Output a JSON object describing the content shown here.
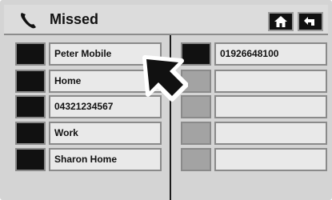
{
  "header": {
    "title": "Missed",
    "home_icon": "home-icon",
    "back_icon": "back-arrow-icon"
  },
  "left_column": {
    "items": [
      {
        "label": "Peter Mobile"
      },
      {
        "label": "Home"
      },
      {
        "label": "04321234567"
      },
      {
        "label": "Work"
      },
      {
        "label": "Sharon Home"
      }
    ]
  },
  "right_column": {
    "items": [
      {
        "label": "01926648100"
      },
      {
        "label": ""
      },
      {
        "label": ""
      },
      {
        "label": ""
      },
      {
        "label": ""
      }
    ]
  },
  "colors": {
    "panel": "#d4d4d4",
    "button_face": "#e9e9e9",
    "indicator_dark": "#111111",
    "indicator_inactive": "#a3a3a3"
  }
}
